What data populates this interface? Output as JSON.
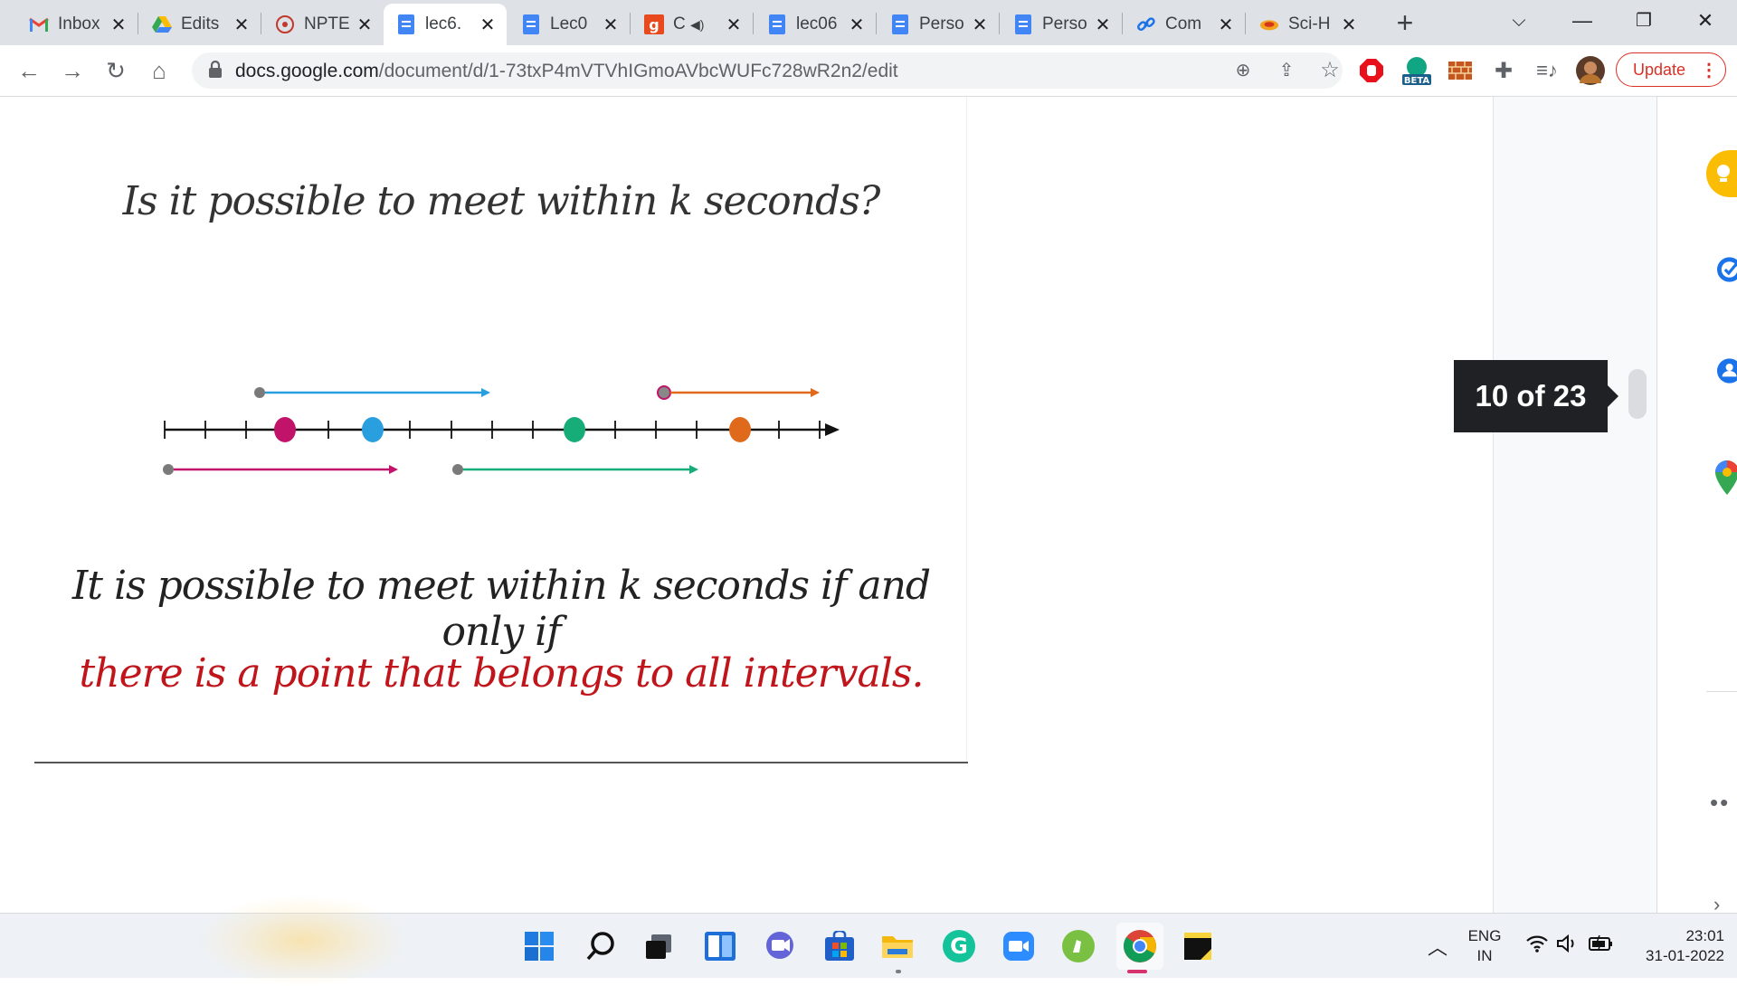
{
  "browser": {
    "tabs": [
      {
        "title": "Inbox",
        "icon": "gmail-icon",
        "active": false
      },
      {
        "title": "Edits",
        "icon": "drive-icon",
        "active": false
      },
      {
        "title": "NPTE",
        "icon": "nptel-icon",
        "active": false
      },
      {
        "title": "lec6.",
        "icon": "docs-icon",
        "active": true
      },
      {
        "title": "Lec0",
        "icon": "docs-icon",
        "active": false
      },
      {
        "title": "C",
        "icon": "g-app-icon",
        "active": false,
        "audio": true
      },
      {
        "title": "lec06",
        "icon": "docs-icon",
        "active": false
      },
      {
        "title": "Perso",
        "icon": "docs-icon",
        "active": false
      },
      {
        "title": "Perso",
        "icon": "docs-icon",
        "active": false
      },
      {
        "title": "Com",
        "icon": "link-icon",
        "active": false
      },
      {
        "title": "Sci-H",
        "icon": "scihub-icon",
        "active": false
      }
    ],
    "url_host": "docs.google.com",
    "url_path": "/document/d/1-73txP4mVTVhIGmoAVbcWUFc728wR2n2/edit",
    "update_label": "Update",
    "beta_label": "BETA"
  },
  "slide": {
    "heading": "Is it possible to meet within k seconds?",
    "statement_line1": "It is possible to meet within k seconds if and only if",
    "statement_line2": "there is a point that belongs to all intervals.",
    "colors": {
      "blue": "#2a9fe0",
      "magenta": "#c2136b",
      "green": "#17ad78",
      "orange": "#e06a1b",
      "red_text": "#c0151b"
    }
  },
  "docs": {
    "page_indicator": "10 of 23"
  },
  "taskbar": {
    "apps": [
      "windows-start-icon",
      "search-icon",
      "task-view-icon",
      "widgets-icon",
      "teams-chat-icon",
      "microsoft-store-icon",
      "file-explorer-icon",
      "grammarly-icon",
      "zoom-icon",
      "evernote-icon",
      "chrome-icon",
      "sticky-notes-icon"
    ],
    "lang_top": "ENG",
    "lang_bottom": "IN",
    "time": "23:01",
    "date": "31-01-2022"
  }
}
